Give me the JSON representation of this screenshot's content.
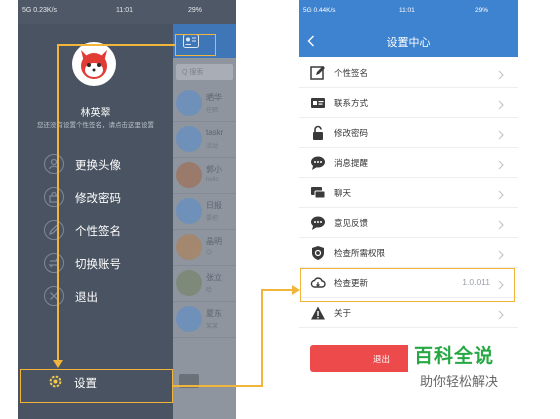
{
  "left_phone": {
    "status_left": "5G 0.23K/s",
    "status_time": "11:01",
    "status_right": "29%",
    "drawer": {
      "user_name": "林英翠",
      "signature_hint": "您还没有设置个性签名，请点击这里设置",
      "menu": [
        {
          "label": "更换头像",
          "icon": "avatar-change-icon"
        },
        {
          "label": "修改密码",
          "icon": "password-icon"
        },
        {
          "label": "个性签名",
          "icon": "signature-icon"
        },
        {
          "label": "切换账号",
          "icon": "switch-account-icon"
        },
        {
          "label": "退出",
          "icon": "exit-icon"
        }
      ],
      "settings_label": "设置"
    },
    "background_app": {
      "search_placeholder": "Q 搜索",
      "chats": [
        {
          "name": "晒华",
          "sub": "任晒"
        },
        {
          "name": "taskr",
          "sub": "活动"
        },
        {
          "name": "郭小",
          "sub": "hello"
        },
        {
          "name": "日报",
          "sub": "要把"
        },
        {
          "name": "晶明",
          "sub": "😊"
        },
        {
          "name": "张立",
          "sub": "哈"
        },
        {
          "name": "夏东",
          "sub": "某某"
        }
      ]
    }
  },
  "right_phone": {
    "status_left": "5G 0.44K/s",
    "status_time": "11:01",
    "status_right": "29%",
    "title": "设置中心",
    "rows": [
      {
        "label": "个性签名",
        "icon": "edit-signature-icon",
        "value": ""
      },
      {
        "label": "联系方式",
        "icon": "contact-card-icon",
        "value": ""
      },
      {
        "label": "修改密码",
        "icon": "lock-icon",
        "value": ""
      },
      {
        "label": "消息提醒",
        "icon": "message-bubble-icon",
        "value": ""
      },
      {
        "label": "聊天",
        "icon": "chat-icon",
        "value": ""
      },
      {
        "label": "意见反馈",
        "icon": "feedback-icon",
        "value": ""
      },
      {
        "label": "检查所需权限",
        "icon": "shield-icon",
        "value": ""
      },
      {
        "label": "检查更新",
        "icon": "cloud-update-icon",
        "value": "1.0.011"
      },
      {
        "label": "关于",
        "icon": "warning-icon",
        "value": ""
      }
    ],
    "logout_label": "退出"
  },
  "watermark": {
    "main": "百科全说",
    "sub": "助你轻松解决"
  },
  "colors": {
    "drawer_bg": "#4a5361",
    "header_blue": "#3e83cf",
    "annotation": "#f2b53c",
    "logout_red": "#ed4b4b",
    "watermark_green": "#27a844"
  }
}
